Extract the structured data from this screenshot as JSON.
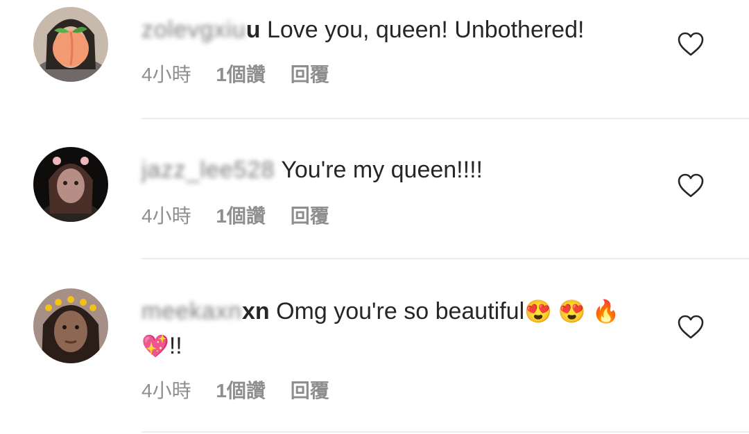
{
  "comments": [
    {
      "user_hidden": "zolevgxiu",
      "user_visible": "u",
      "text": "Love you, queen! Unbothered!",
      "time": "4小時",
      "likes": "1個讚",
      "reply": "回覆",
      "avatar_color": "#d9c7b8"
    },
    {
      "user_hidden": "jazz_lee528",
      "user_visible": "",
      "text": "You're my queen!!!!",
      "time": "4小時",
      "likes": "1個讚",
      "reply": "回覆",
      "avatar_color": "#3a2a2a"
    },
    {
      "user_hidden": "meekaxn",
      "user_visible": "xn",
      "text": "Omg you're so beautiful",
      "emojis": "😍 😍 🔥 💖",
      "text_suffix": "!!",
      "time": "4小時",
      "likes": "1個讚",
      "reply": "回覆",
      "avatar_color": "#6a4a3a"
    }
  ]
}
